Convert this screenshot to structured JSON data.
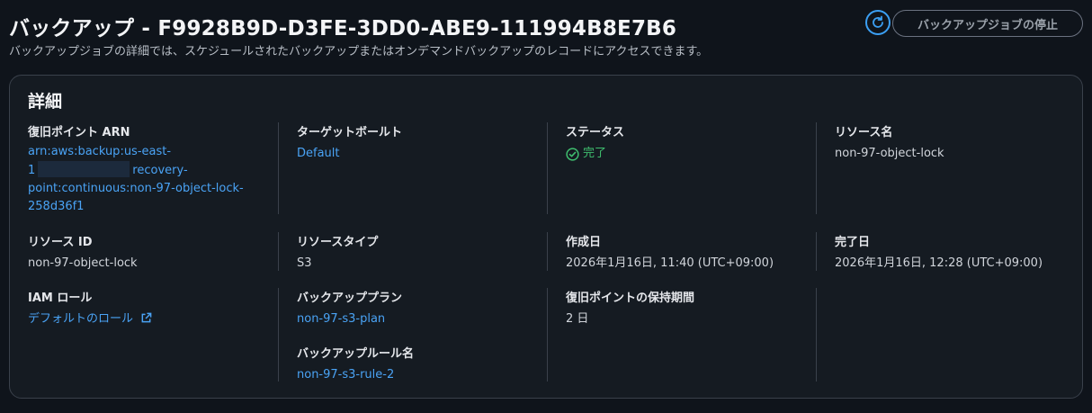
{
  "header": {
    "title": "バックアップ - F9928B9D-D3FE-3DD0-ABE9-111994B8E7B6",
    "description": "バックアップジョブの詳細では、スケジュールされたバックアップまたはオンデマンドバックアップのレコードにアクセスできます。",
    "stop_button_label": "バックアップジョブの停止",
    "refresh_icon": "refresh-icon"
  },
  "details": {
    "title": "詳細",
    "recovery_point_arn": {
      "label": "復旧ポイント ARN",
      "line1": "arn:aws:backup:us-east-",
      "line2_prefix": "1",
      "line2_suffix": "recovery-",
      "line3": "point:continuous:non-97-object-lock-",
      "line4": "258d36f1"
    },
    "target_vault": {
      "label": "ターゲットボールト",
      "value": "Default"
    },
    "status": {
      "label": "ステータス",
      "value": "完了",
      "color": "#3fbf6f"
    },
    "resource_name": {
      "label": "リソース名",
      "value": "non-97-object-lock"
    },
    "resource_id": {
      "label": "リソース ID",
      "value": "non-97-object-lock"
    },
    "resource_type": {
      "label": "リソースタイプ",
      "value": "S3"
    },
    "created_date": {
      "label": "作成日",
      "value": "2026年1月16日, 11:40 (UTC+09:00)"
    },
    "completed_date": {
      "label": "完了日",
      "value": "2026年1月16日, 12:28 (UTC+09:00)"
    },
    "iam_role": {
      "label": "IAM ロール",
      "value": "デフォルトのロール"
    },
    "backup_plan": {
      "label": "バックアッププラン",
      "value": "non-97-s3-plan"
    },
    "backup_rule": {
      "label": "バックアップルール名",
      "value": "non-97-s3-rule-2"
    },
    "retention": {
      "label": "復旧ポイントの保持期間",
      "value": "2 日"
    }
  },
  "colors": {
    "link": "#4aa3f5",
    "accent": "#3b9ff3",
    "background": "#0f141b"
  }
}
